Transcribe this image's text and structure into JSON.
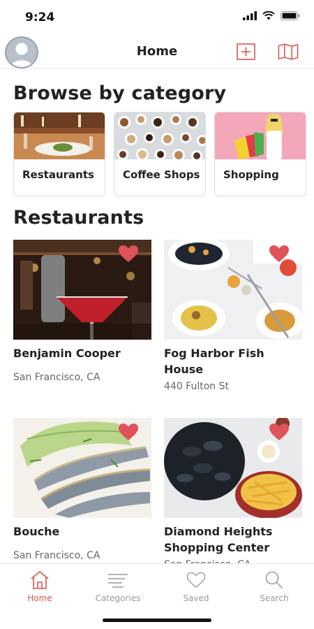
{
  "status": {
    "time": "9:24"
  },
  "nav": {
    "title": "Home"
  },
  "browse": {
    "heading": "Browse by category",
    "categories": [
      {
        "label": "Restaurants"
      },
      {
        "label": "Coffee Shops"
      },
      {
        "label": "Shopping"
      }
    ]
  },
  "restaurants": {
    "heading": "Restaurants",
    "items": [
      {
        "name": "Benjamin Cooper",
        "address": "San Francisco, CA"
      },
      {
        "name": "Fog Harbor Fish House",
        "address": "440 Fulton St"
      },
      {
        "name": "Bouche",
        "address": "San Francisco, CA"
      },
      {
        "name": "Diamond Heights Shopping Center",
        "address": "San Francisco, CA"
      }
    ]
  },
  "tabs": [
    {
      "label": "Home",
      "icon": "home-icon",
      "active": true
    },
    {
      "label": "Categories",
      "icon": "categories-icon"
    },
    {
      "label": "Saved",
      "icon": "heart-icon"
    },
    {
      "label": "Search",
      "icon": "search-icon"
    }
  ],
  "colors": {
    "accent": "#d9534f",
    "heart": "#e0525a"
  }
}
